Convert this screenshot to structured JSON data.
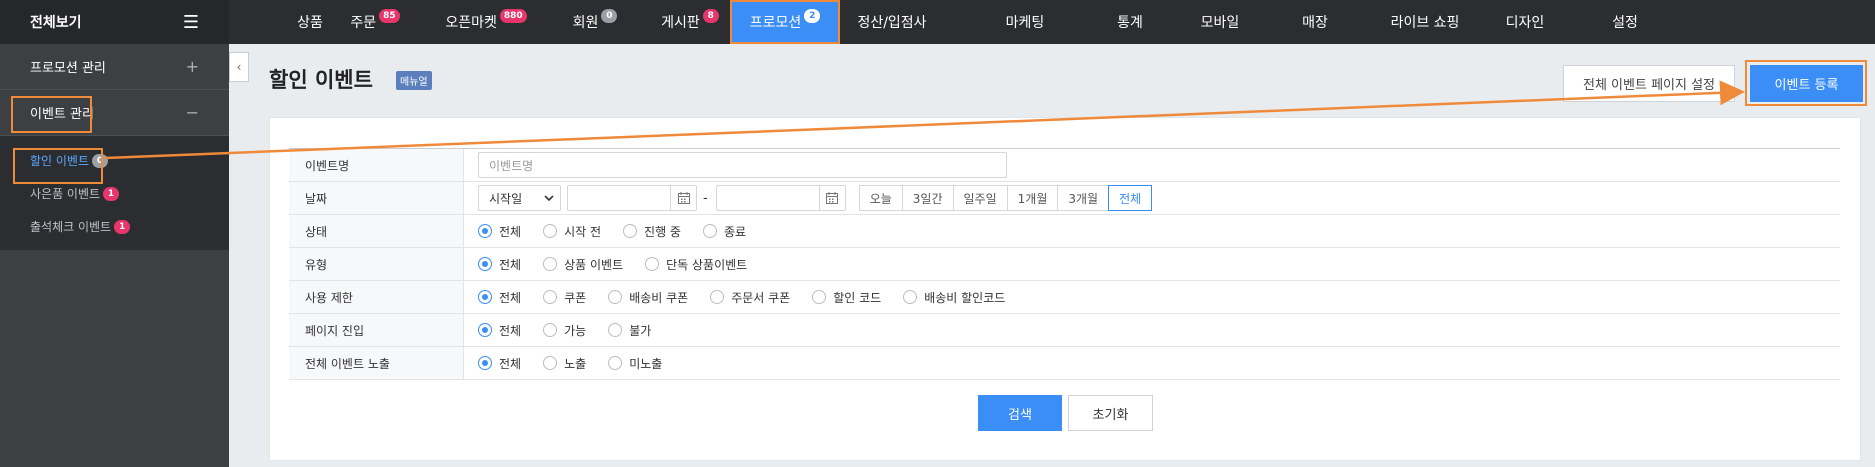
{
  "brand": {
    "label": "전체보기"
  },
  "topnav": [
    {
      "label": "상품",
      "badge": ""
    },
    {
      "label": "주문",
      "badge": "85"
    },
    {
      "label": "오픈마켓",
      "badge": "880"
    },
    {
      "label": "회원",
      "badge": "0"
    },
    {
      "label": "게시판",
      "badge": "8"
    },
    {
      "label": "프로모션",
      "badge": "2",
      "active": true
    },
    {
      "label": "정산/입점사",
      "badge": ""
    },
    {
      "label": "마케팅",
      "badge": ""
    },
    {
      "label": "통계",
      "badge": ""
    },
    {
      "label": "모바일",
      "badge": ""
    },
    {
      "label": "매장",
      "badge": ""
    },
    {
      "label": "라이브 쇼핑",
      "badge": ""
    },
    {
      "label": "디자인",
      "badge": ""
    },
    {
      "label": "설정",
      "badge": ""
    }
  ],
  "sidebar": {
    "sections": [
      {
        "label": "프로모션 관리",
        "toggle": "+"
      },
      {
        "label": "이벤트 관리",
        "toggle": "−"
      }
    ],
    "items": [
      {
        "label": "할인 이벤트",
        "badge": "0",
        "active": true
      },
      {
        "label": "사은품 이벤트",
        "badge": "1"
      },
      {
        "label": "출석체크 이벤트",
        "badge": "1"
      }
    ]
  },
  "page": {
    "title": "할인 이벤트",
    "manual": "메뉴얼",
    "page_setting_button": "전체 이벤트 페이지 설정",
    "register_button": "이벤트 등록"
  },
  "form": {
    "event_name": {
      "label": "이벤트명",
      "placeholder": "이벤트명"
    },
    "date": {
      "label": "날짜",
      "select_value": "시작일",
      "dash": "-",
      "ranges": [
        "오늘",
        "3일간",
        "일주일",
        "1개월",
        "3개월",
        "전체"
      ],
      "selected_range": "전체"
    },
    "status": {
      "label": "상태",
      "options": [
        "전체",
        "시작 전",
        "진행 중",
        "종료"
      ]
    },
    "type": {
      "label": "유형",
      "options": [
        "전체",
        "상품 이벤트",
        "단독 상품이벤트"
      ]
    },
    "usage": {
      "label": "사용 제한",
      "options": [
        "전체",
        "쿠폰",
        "배송비 쿠폰",
        "주문서 쿠폰",
        "할인 코드",
        "배송비 할인코드"
      ]
    },
    "page_entry": {
      "label": "페이지 진입",
      "options": [
        "전체",
        "가능",
        "불가"
      ]
    },
    "exposure": {
      "label": "전체 이벤트 노출",
      "options": [
        "전체",
        "노출",
        "미노출"
      ]
    }
  },
  "actions": {
    "search": "검색",
    "reset": "초기화"
  },
  "colors": {
    "accent": "#3a8ef6",
    "highlight": "#f08a3b",
    "badge": "#e8356b"
  }
}
